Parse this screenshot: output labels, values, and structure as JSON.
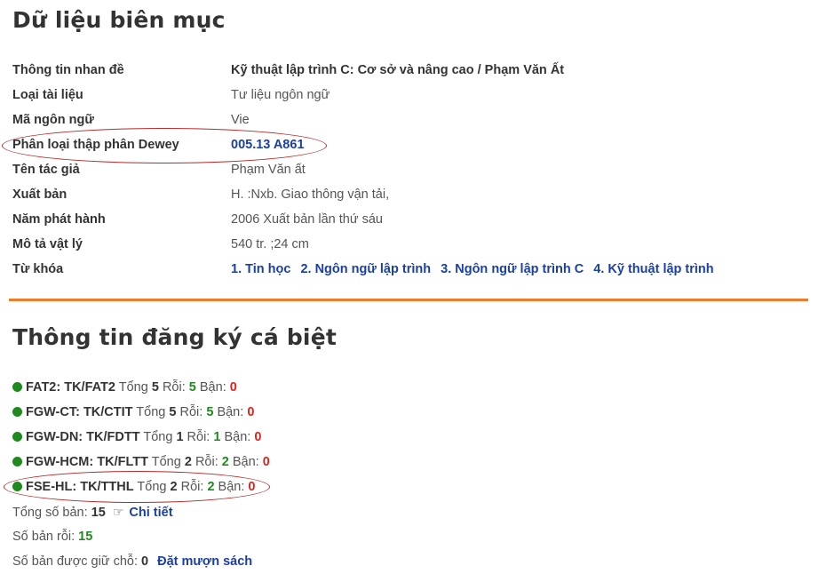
{
  "catalog": {
    "title": "Dữ liệu biên mục",
    "rows": [
      {
        "label": "Thông tin nhan đề",
        "value": "Kỹ thuật lập trình C: Cơ sở và nâng cao / Phạm Văn Ất"
      },
      {
        "label": "Loại tài liệu",
        "value": "Tư liệu ngôn ngữ"
      },
      {
        "label": "Mã ngôn ngữ",
        "value": "Vie"
      },
      {
        "label": "Phân loại thập phân Dewey",
        "value": "005.13 A861"
      },
      {
        "label": "Tên tác giả",
        "value": "Phạm Văn ất"
      },
      {
        "label": "Xuất bản",
        "value": "H. :Nxb. Giao thông vận tải,"
      },
      {
        "label": "Năm phát hành",
        "value": "2006 Xuất bản lần thứ sáu"
      },
      {
        "label": "Mô tả vật lý",
        "value": "540 tr. ;24 cm"
      },
      {
        "label": "Từ khóa",
        "keywords": [
          "1. Tin học",
          "2. Ngôn ngữ lập trình",
          "3. Ngôn ngữ lập trình C",
          "4. Kỹ thuật lập trình"
        ]
      }
    ]
  },
  "copies": {
    "title": "Thông tin đăng ký cá biệt",
    "total_label": "Tổng",
    "free_label": "Rỗi:",
    "busy_label": "Bận:",
    "items": [
      {
        "code": "FAT2: TK/FAT2",
        "total": "5",
        "free": "5",
        "busy": "0"
      },
      {
        "code": "FGW-CT: TK/CTIT",
        "total": "5",
        "free": "5",
        "busy": "0"
      },
      {
        "code": "FGW-DN: TK/FDTT",
        "total": "1",
        "free": "1",
        "busy": "0"
      },
      {
        "code": "FGW-HCM: TK/FLTT",
        "total": "2",
        "free": "2",
        "busy": "0"
      },
      {
        "code": "FSE-HL: TK/TTHL",
        "total": "2",
        "free": "2",
        "busy": "0"
      }
    ],
    "summary": {
      "total_label": "Tổng số bản:",
      "total_value": "15",
      "details_link": "Chi tiết",
      "free_label": "Số bản rỗi:",
      "free_value": "15",
      "reserved_label": "Số bản được giữ chỗ:",
      "reserved_value": "0",
      "reserve_link": "Đặt mượn sách"
    }
  },
  "colors": {
    "accent_orange": "#f07a2b",
    "link_blue": "#1b3fa8",
    "green": "#1e8a1e",
    "red": "#d9261c",
    "annotation": "#b22a2a"
  },
  "icons": {
    "status": "green-dot-icon",
    "pointer": "hand-pointer-icon"
  }
}
